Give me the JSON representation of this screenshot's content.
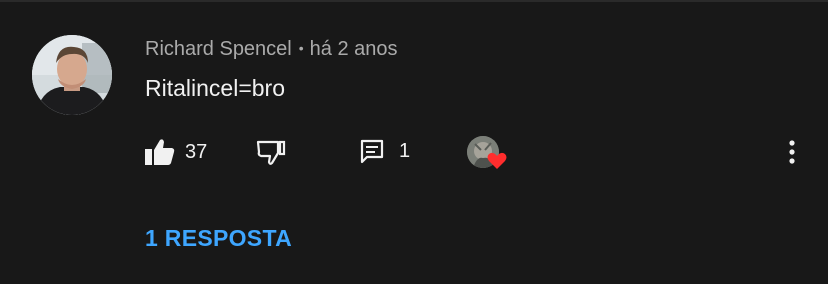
{
  "comment": {
    "author": "Richard Spencel",
    "separator": "•",
    "timestamp": "há 2 anos",
    "text": "Ritalincel=bro",
    "likes": "37",
    "replies_count": "1",
    "replies_link": "1 RESPOSTA",
    "creator_hearted": true
  },
  "icons": {
    "like": "thumbs-up-icon",
    "dislike": "thumbs-down-icon",
    "reply": "comment-icon",
    "heart": "heart-icon",
    "more": "more-vertical-icon"
  },
  "colors": {
    "background": "#181818",
    "text": "#f1f1f1",
    "meta": "#aaaaaa",
    "link": "#3ea6ff",
    "heart": "#ff2d2d"
  }
}
